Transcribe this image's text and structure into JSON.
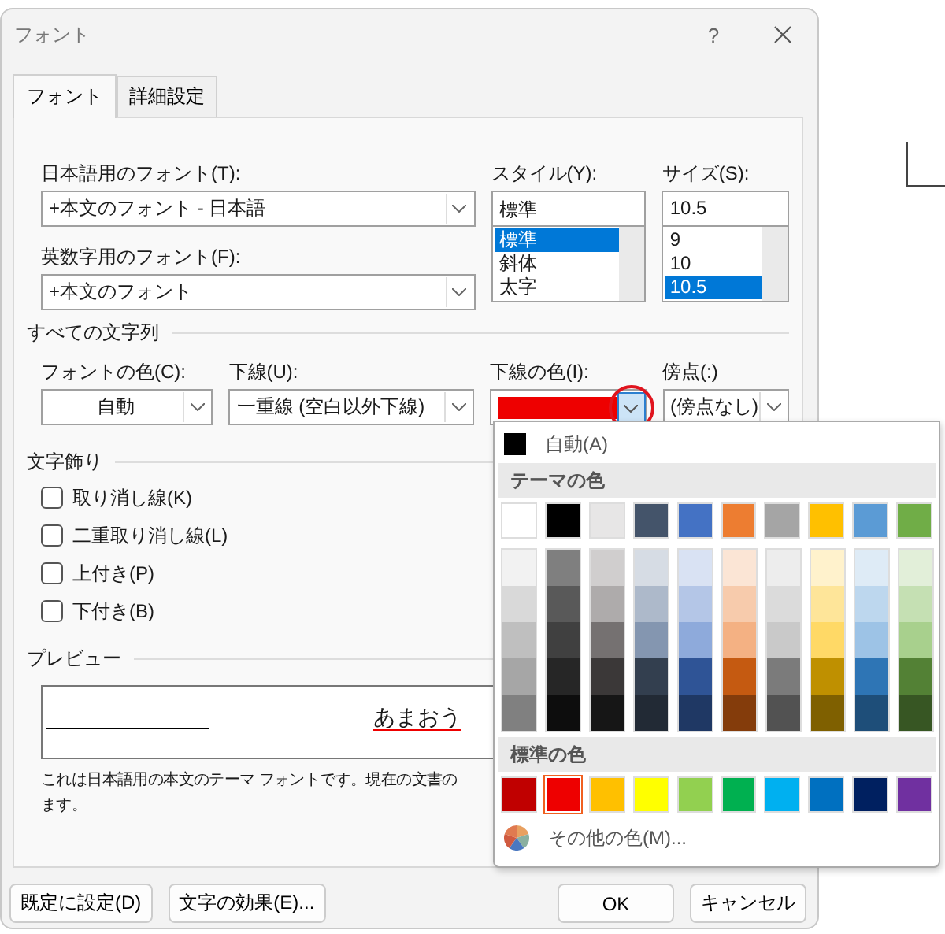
{
  "window": {
    "title": "フォント",
    "help": "?"
  },
  "tabs": [
    {
      "label": "フォント",
      "selected": true
    },
    {
      "label": "詳細設定",
      "selected": false
    }
  ],
  "font": {
    "japanese_font": {
      "label": "日本語用のフォント(T):",
      "value": "+本文のフォント - 日本語"
    },
    "latin_font": {
      "label": "英数字用のフォント(F):",
      "value": "+本文のフォント"
    },
    "style": {
      "label": "スタイル(Y):",
      "value": "標準",
      "options": [
        {
          "label": "標準",
          "selected": true
        },
        {
          "label": "斜体",
          "selected": false
        },
        {
          "label": "太字",
          "selected": false
        }
      ]
    },
    "size": {
      "label": "サイズ(S):",
      "value": "10.5",
      "options": [
        {
          "label": "9",
          "selected": false
        },
        {
          "label": "10",
          "selected": false
        },
        {
          "label": "10.5",
          "selected": true
        }
      ]
    }
  },
  "all_text": {
    "title": "すべての文字列",
    "font_color": {
      "label": "フォントの色(C):",
      "value": "自動"
    },
    "underline": {
      "label": "下線(U):",
      "value": "一重線 (空白以外下線)"
    },
    "underline_color": {
      "label": "下線の色(I):",
      "color": "#ee0000",
      "open": true,
      "highlighted": true
    },
    "emphasis": {
      "label": "傍点(:)",
      "value": "(傍点なし)"
    }
  },
  "effects": {
    "title": "文字飾り",
    "checkboxes": [
      {
        "label": "取り消し線(K)",
        "checked": false
      },
      {
        "label": "二重取り消し線(L)",
        "checked": false
      },
      {
        "label": "上付き(P)",
        "checked": false
      },
      {
        "label": "下付き(B)",
        "checked": false
      }
    ]
  },
  "preview": {
    "title": "プレビュー",
    "sample": "あまおう",
    "description": [
      "これは日本語用の本文のテーマ フォントです。現在の文書の",
      "ます。"
    ]
  },
  "buttons": [
    {
      "label": "既定に設定(D)"
    },
    {
      "label": "文字の効果(E)..."
    }
  ],
  "dialog_buttons": [
    {
      "label": "OK"
    },
    {
      "label": "キャンセル"
    }
  ],
  "color_menu": {
    "automatic": "自動(A)",
    "theme_title": "テーマの色",
    "theme_colors": [
      {
        "color": "#ffffff",
        "shades": [
          {
            "color": "#f2f2f2"
          },
          {
            "color": "#d9d9d9"
          },
          {
            "color": "#bfbfbf"
          },
          {
            "color": "#a6a6a6"
          },
          {
            "color": "#808080"
          }
        ]
      },
      {
        "color": "#000000",
        "shades": [
          {
            "color": "#7f7f7f"
          },
          {
            "color": "#595959"
          },
          {
            "color": "#404040"
          },
          {
            "color": "#262626"
          },
          {
            "color": "#0d0d0d"
          }
        ]
      },
      {
        "color": "#e7e6e6",
        "shades": [
          {
            "color": "#d0cece"
          },
          {
            "color": "#aeabab"
          },
          {
            "color": "#757171"
          },
          {
            "color": "#3b3838"
          },
          {
            "color": "#161616"
          }
        ]
      },
      {
        "color": "#44546a",
        "shades": [
          {
            "color": "#d6dce4"
          },
          {
            "color": "#adb9ca"
          },
          {
            "color": "#8496b0"
          },
          {
            "color": "#333f4f"
          },
          {
            "color": "#222a35"
          }
        ]
      },
      {
        "color": "#4472c4",
        "shades": [
          {
            "color": "#d9e2f3"
          },
          {
            "color": "#b4c6e7"
          },
          {
            "color": "#8eaadb"
          },
          {
            "color": "#2f5496"
          },
          {
            "color": "#1f3864"
          }
        ]
      },
      {
        "color": "#ed7d31",
        "shades": [
          {
            "color": "#fbe5d5"
          },
          {
            "color": "#f7cbac"
          },
          {
            "color": "#f4b183"
          },
          {
            "color": "#c55a11"
          },
          {
            "color": "#843c0b"
          }
        ]
      },
      {
        "color": "#a5a5a5",
        "shades": [
          {
            "color": "#ededed"
          },
          {
            "color": "#dbdbdb"
          },
          {
            "color": "#c9c9c9"
          },
          {
            "color": "#7b7b7b"
          },
          {
            "color": "#525252"
          }
        ]
      },
      {
        "color": "#ffc000",
        "shades": [
          {
            "color": "#fff2cc"
          },
          {
            "color": "#fee599"
          },
          {
            "color": "#ffd966"
          },
          {
            "color": "#bf9000"
          },
          {
            "color": "#7f6000"
          }
        ]
      },
      {
        "color": "#5b9bd5",
        "shades": [
          {
            "color": "#deebf6"
          },
          {
            "color": "#bdd7ee"
          },
          {
            "color": "#9dc3e6"
          },
          {
            "color": "#2e75b5"
          },
          {
            "color": "#1e4e79"
          }
        ]
      },
      {
        "color": "#70ad47",
        "shades": [
          {
            "color": "#e2efd9"
          },
          {
            "color": "#c5e0b3"
          },
          {
            "color": "#a8d08d"
          },
          {
            "color": "#538135"
          },
          {
            "color": "#375623"
          }
        ]
      }
    ],
    "standard_title": "標準の色",
    "standard_colors": [
      {
        "color": "#c00000",
        "selected": false
      },
      {
        "color": "#ee0000",
        "selected": true
      },
      {
        "color": "#ffc000",
        "selected": false
      },
      {
        "color": "#ffff00",
        "selected": false
      },
      {
        "color": "#92d050",
        "selected": false
      },
      {
        "color": "#00b050",
        "selected": false
      },
      {
        "color": "#00b0f0",
        "selected": false
      },
      {
        "color": "#0070c0",
        "selected": false
      },
      {
        "color": "#002060",
        "selected": false
      },
      {
        "color": "#7030a0",
        "selected": false
      }
    ],
    "more_colors": "その他の色(M)..."
  }
}
